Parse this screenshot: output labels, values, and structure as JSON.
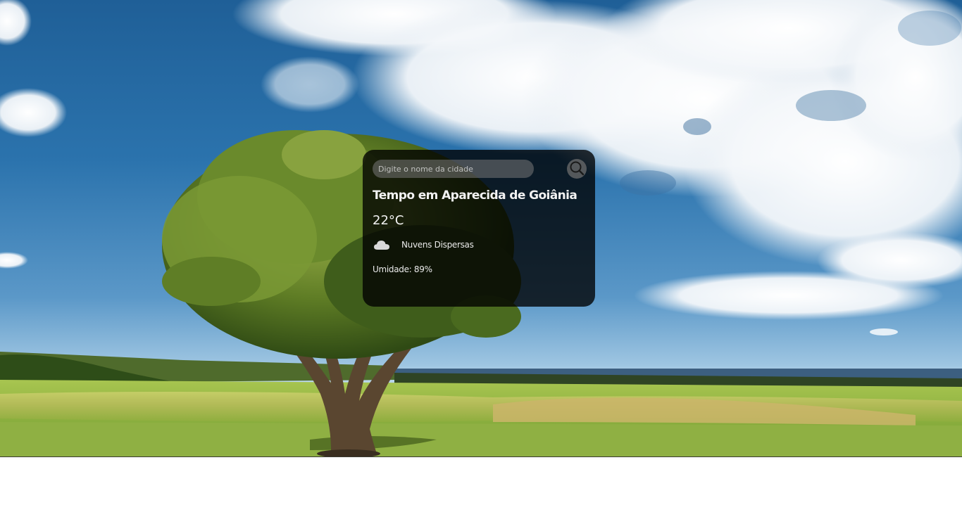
{
  "search": {
    "placeholder": "Digite o nome da cidade",
    "icon": "search-icon"
  },
  "weather": {
    "title": "Tempo em Aparecida de Goiânia",
    "temperature": "22°C",
    "description": "Nuvens Dispersas",
    "icon": "cloud-icon",
    "humidity": "Umidade: 89%"
  },
  "background": {
    "sky_color": "#2b73ad",
    "grass_color": "#8aa63a",
    "card_color": "#000000"
  }
}
